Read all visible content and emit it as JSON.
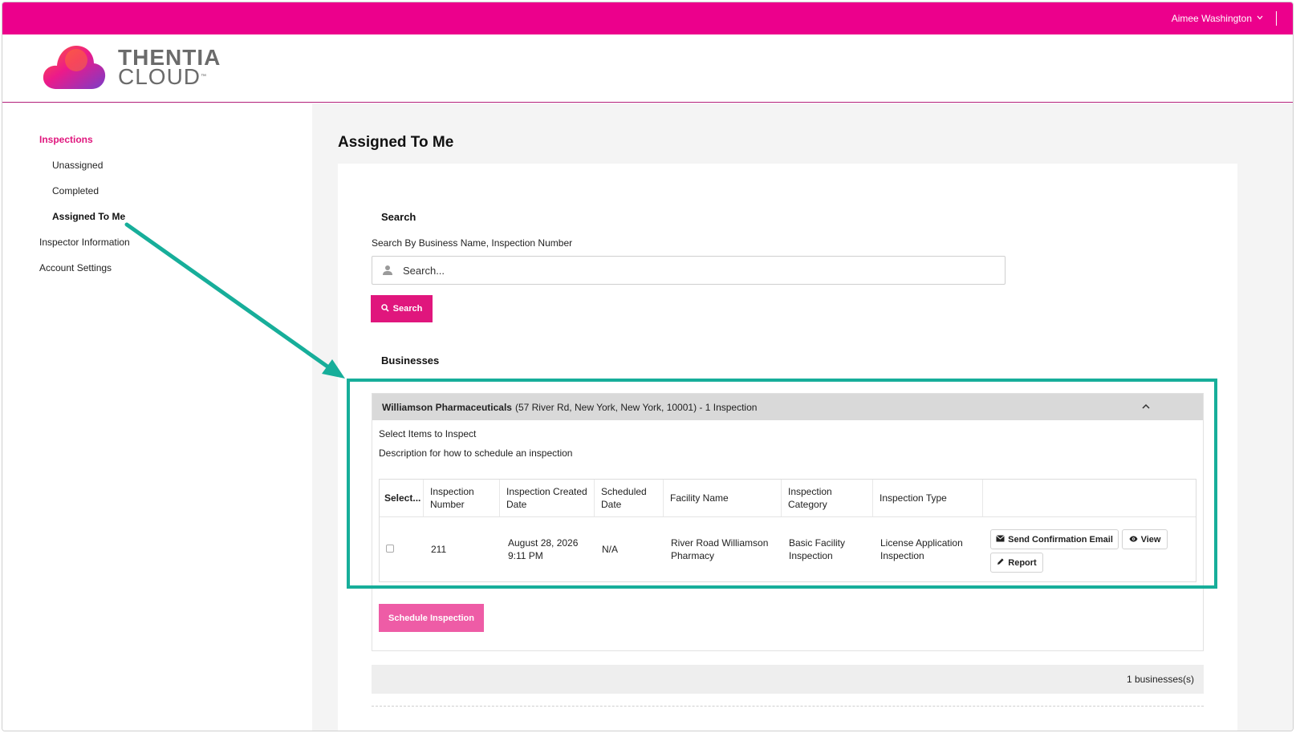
{
  "topbar": {
    "user_name": "Aimee Washington",
    "brand_color": "#ec008c"
  },
  "logo": {
    "line1": "THENTIA",
    "line2": "CLOUD",
    "trademark": "™"
  },
  "sidebar": {
    "section": "Inspections",
    "items": [
      {
        "label": "Unassigned"
      },
      {
        "label": "Completed"
      },
      {
        "label": "Assigned To Me",
        "current": true
      }
    ],
    "links": [
      {
        "label": "Inspector Information"
      },
      {
        "label": "Account Settings"
      }
    ]
  },
  "main": {
    "title": "Assigned To Me",
    "search": {
      "heading": "Search",
      "hint": "Search By Business Name, Inspection Number",
      "placeholder": "Search...",
      "button_label": "Search"
    },
    "businesses": {
      "heading": "Businesses",
      "panel": {
        "name": "Williamson Pharmaceuticals",
        "details": "(57 River Rd, New York, New York, 10001) - 1 Inspection",
        "select_title": "Select Items to Inspect",
        "description": "Description for how to schedule an inspection",
        "columns": [
          "Select...",
          "Inspection Number",
          "Inspection Created Date",
          "Scheduled Date",
          "Facility Name",
          "Inspection Category",
          "Inspection Type"
        ],
        "rows": [
          {
            "inspection_number": "211",
            "created_date": "August 28, 2026 9:11 PM",
            "scheduled_date": "N/A",
            "facility_name": "River Road Williamson Pharmacy",
            "category": "Basic Facility Inspection",
            "type": "License Application Inspection",
            "actions": {
              "send_email": "Send Confirmation Email",
              "view": "View",
              "report": "Report"
            }
          }
        ],
        "schedule_button": "Schedule Inspection"
      },
      "count_text": "1 businesses(s)"
    }
  },
  "annotation": {
    "color": "#17ae9a"
  }
}
